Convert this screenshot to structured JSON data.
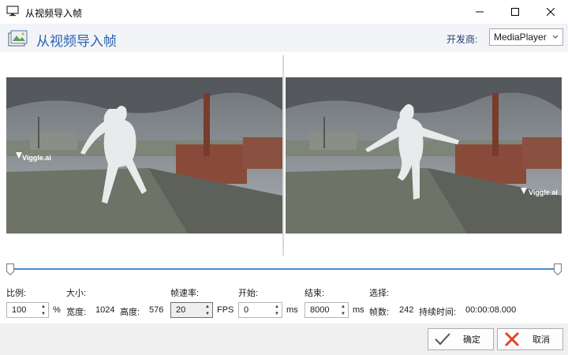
{
  "window": {
    "title": "从视频导入帧"
  },
  "header": {
    "title": "从视频导入帧",
    "developer_label": "开发商:",
    "developer_value": "MediaPlayer"
  },
  "preview": {
    "left_watermark": "Viggle.ai",
    "right_watermark": "Viggle.ai"
  },
  "controls": {
    "scale_label": "比例:",
    "scale_value": "100",
    "scale_unit": "%",
    "size_label": "大小:",
    "width_label": "宽度:",
    "width_value": "1024",
    "height_label": "高度:",
    "height_value": "576",
    "fps_label": "帧速率:",
    "fps_value": "20",
    "fps_unit": "FPS",
    "start_label": "开始:",
    "start_value": "0",
    "start_unit": "ms",
    "end_label": "结束:",
    "end_value": "8000",
    "end_unit": "ms",
    "select_label": "选择:",
    "frames_label": "帧数:",
    "frames_value": "242",
    "duration_label": "持续时间:",
    "duration_value": "00:00:08.000"
  },
  "buttons": {
    "ok_label": "确定",
    "cancel_label": "取消"
  },
  "colors": {
    "accent": "#2a64b0",
    "slider": "#4a8bd6",
    "ok_check": "#555555",
    "cancel_x": "#e0452b"
  },
  "icons": {
    "app": "monitor-icon",
    "header": "film-frame-icon",
    "ok": "check-icon",
    "cancel": "x-icon"
  }
}
